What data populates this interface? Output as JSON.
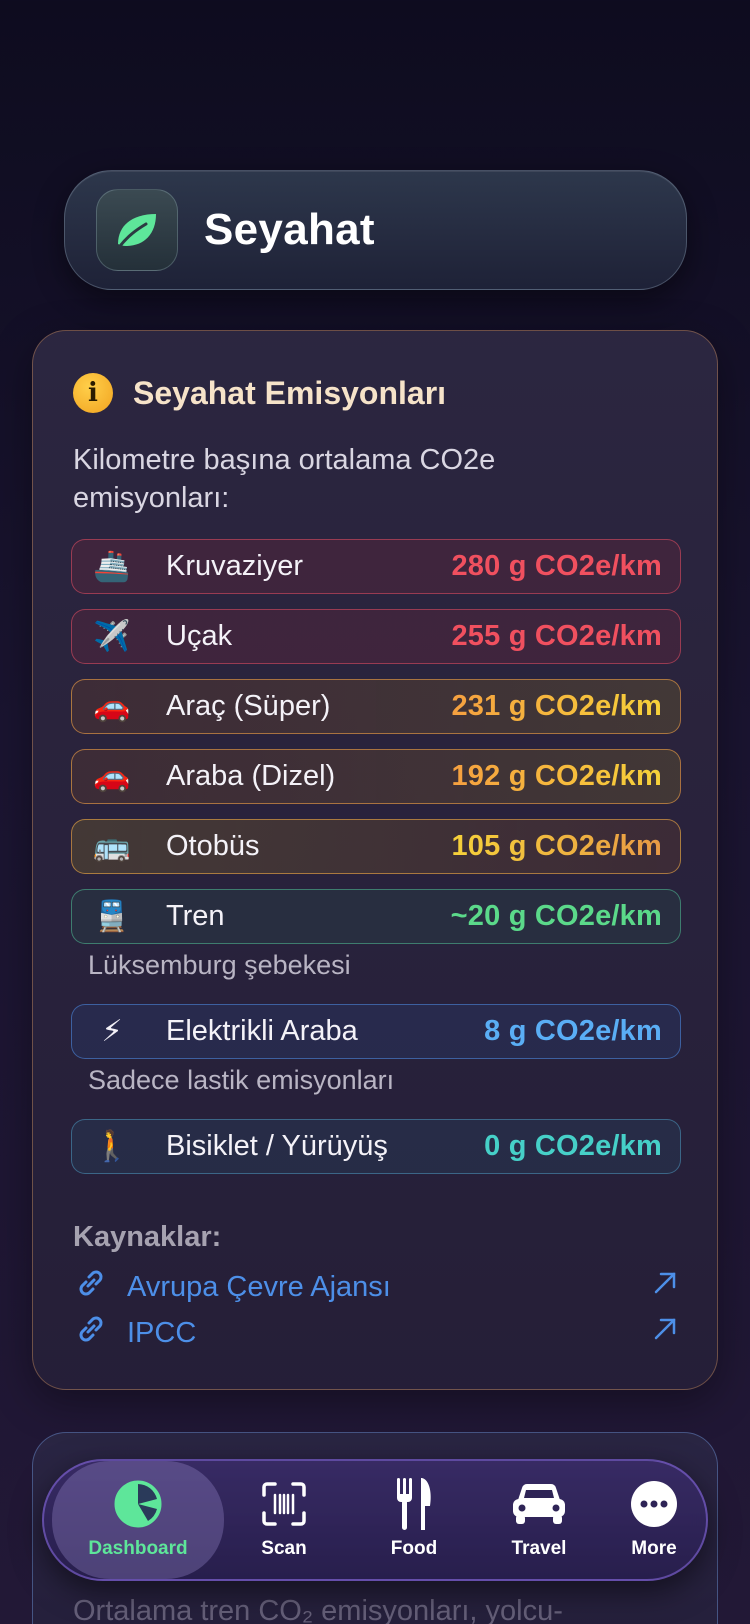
{
  "header": {
    "title": "Seyahat",
    "icon": "leaf-icon"
  },
  "card": {
    "title": "Seyahat Emisyonları",
    "description": "Kilometre başına ortalama CO2e emisyonları:",
    "rows": [
      {
        "emoji": "🚢",
        "label": "Kruvaziyer",
        "value": "280 g CO2e/km",
        "color": "#f0505f"
      },
      {
        "emoji": "✈️",
        "label": "Uçak",
        "value": "255 g CO2e/km",
        "color": "#f0505f"
      },
      {
        "emoji": "🚗",
        "label": "Araç (Süper)",
        "value": "231 g CO2e/km",
        "color": "#f7a23c"
      },
      {
        "emoji": "🚗",
        "label": "Araba (Dizel)",
        "value": "192 g CO2e/km",
        "color": "#f7a23c"
      },
      {
        "emoji": "🚌",
        "label": "Otobüs",
        "value": "105 g CO2e/km",
        "color": "#f0c030"
      },
      {
        "emoji": "🚆",
        "label": "Tren",
        "value": "~20 g CO2e/km",
        "color": "#5bd98a",
        "note": "Lüksemburg şebekesi"
      },
      {
        "emoji": "⚡",
        "label": "Elektrikli Araba",
        "value": "8 g CO2e/km",
        "color": "#5aaef5",
        "note": "Sadece lastik emisyonları"
      },
      {
        "emoji": "🚶",
        "label": "Bisiklet / Yürüyüş",
        "value": "0 g CO2e/km",
        "color": "#46d0c8"
      }
    ],
    "sources_title": "Kaynaklar:",
    "sources": [
      {
        "label": "Avrupa Çevre Ajansı"
      },
      {
        "label": "IPCC"
      }
    ]
  },
  "card2": {
    "peek_text": "Ortalama tren CO₂ emisyonları, yolcu-"
  },
  "tabbar": {
    "tabs": [
      {
        "label": "Dashboard",
        "icon": "pie-chart-icon",
        "active": true
      },
      {
        "label": "Scan",
        "icon": "barcode-scan-icon",
        "active": false
      },
      {
        "label": "Food",
        "icon": "fork-knife-icon",
        "active": false
      },
      {
        "label": "Travel",
        "icon": "car-icon",
        "active": false
      },
      {
        "label": "More",
        "icon": "more-icon",
        "active": false
      }
    ]
  },
  "colors": {
    "accent_green": "#5ee69a",
    "link_blue": "#4d8fe8",
    "card_border": "#c88c5a"
  }
}
